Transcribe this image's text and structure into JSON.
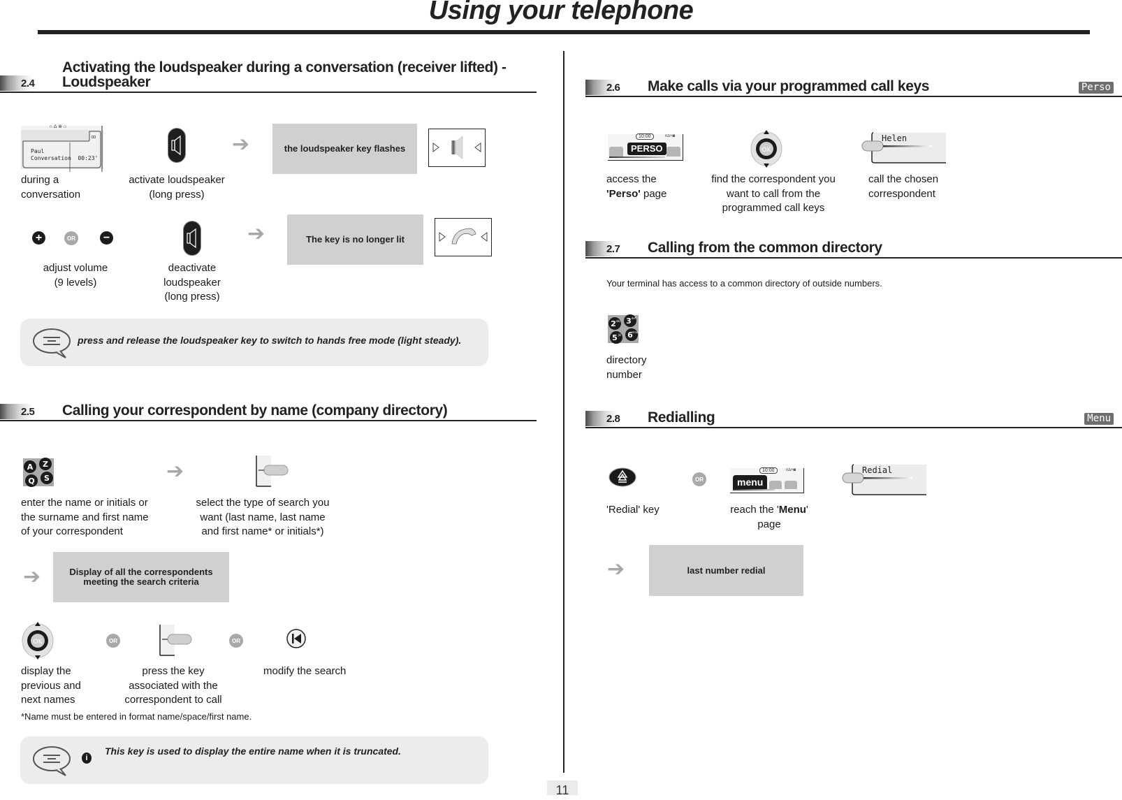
{
  "header": {
    "title": "Using your telephone"
  },
  "page_number": "11",
  "sections": {
    "s24": {
      "number": "2.4",
      "title_line1": "Activating the loudspeaker during a conversation (receiver lifted) -",
      "title_line2": "Loudspeaker",
      "screen": {
        "icons": "∩ ∆ ⊗ ⌂",
        "name": "Paul",
        "status": "Conversation  00:23'"
      },
      "steps": {
        "during": "during a\nconversation",
        "activate": "activate loudspeaker\n(long press)",
        "flashes": "the loudspeaker key flashes",
        "adjust": "adjust volume\n(9 levels)",
        "or": "OR",
        "deactivate": "deactivate\nloudspeaker\n(long press)",
        "no_longer_lit": "The key is no longer lit"
      },
      "note": "press and release the loudspeaker key to switch to hands free mode (light steady)."
    },
    "s25": {
      "number": "2.5",
      "title": "Calling your correspondent by name (company directory)",
      "keys": [
        "A",
        "Z",
        "Q",
        "S"
      ],
      "steps": {
        "enter": "enter the name or initials or\nthe surname and first name\nof your correspondent",
        "select": "select the type of search you\nwant (last name, last name\nand first name* or initials*)",
        "display": "Display of all the correspondents\nmeeting the search criteria",
        "prev_next": "display the\nprevious and\nnext names",
        "or": "OR",
        "press_key": "press the key\nassociated with the\ncorrespondent to call",
        "modify": "modify the search",
        "ok": "OK"
      },
      "footnote": "*Name must be entered in format name/space/first name.",
      "note": "This key is used to display the entire name when it is truncated."
    },
    "s26": {
      "number": "2.6",
      "title": "Make calls via your programmed call keys",
      "tag": "Perso",
      "screen": {
        "time": "10:00",
        "label": "PERSO",
        "status": "n∆+◙"
      },
      "key_label": "Helen",
      "ok": "OK",
      "steps": {
        "access_pre": "access the",
        "access_bold": "'Perso'",
        "access_post": " page",
        "find": "find the correspondent you\nwant to call from the\nprogrammed call keys",
        "call": "call the chosen\ncorrespondent"
      }
    },
    "s27": {
      "number": "2.7",
      "title": "Calling from the common directory",
      "intro": "Your terminal has access to a common directory of outside numbers.",
      "keys": [
        "2",
        "3",
        "5",
        "6"
      ],
      "key_sub": [
        "abc",
        "def",
        "jkl",
        "mno"
      ],
      "caption": "directory\nnumber"
    },
    "s28": {
      "number": "2.8",
      "title": "Redialling",
      "tag": "Menu",
      "screen": {
        "time": "10:00",
        "label": "menu",
        "status": "n∆+◙"
      },
      "key_label": "Redial",
      "steps": {
        "redial_key": "'Redial' key",
        "or": "OR",
        "reach_pre": "reach the '",
        "reach_bold": "Menu",
        "reach_post": "'\npage",
        "last_number": "last number redial"
      }
    }
  }
}
